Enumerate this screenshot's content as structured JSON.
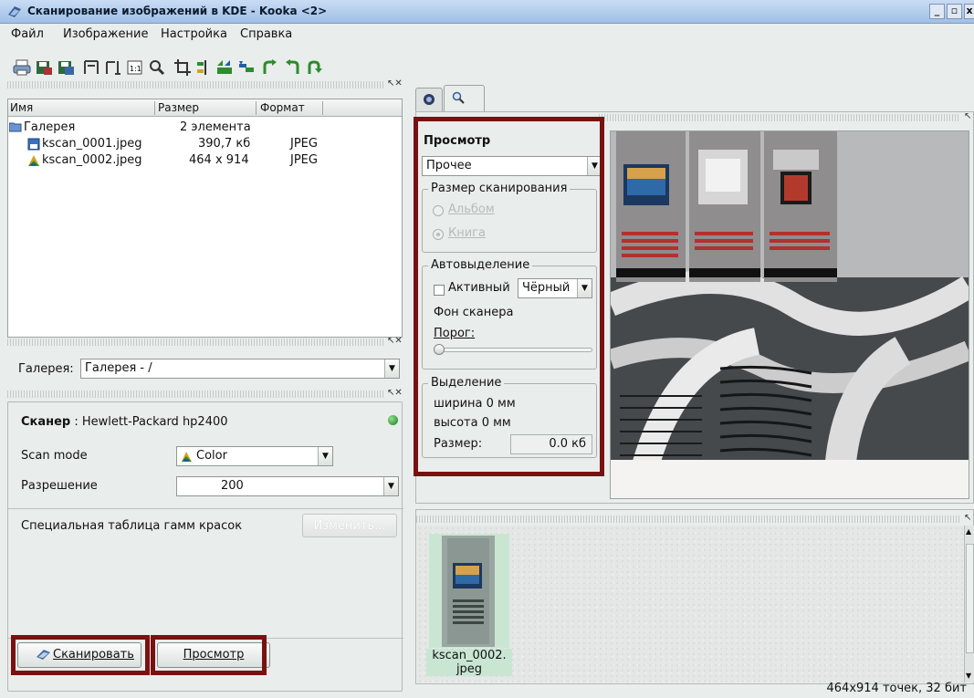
{
  "window": {
    "title": "Сканирование изображений в KDE - Kooka <2>",
    "controls": [
      "_",
      "▫",
      "×"
    ]
  },
  "menu": [
    {
      "label": "Файл"
    },
    {
      "label": "Изображение"
    },
    {
      "label": "Настройка"
    },
    {
      "label": "Справка"
    }
  ],
  "gallery": {
    "columns": [
      "Имя",
      "Размер",
      "Формат"
    ],
    "folder": {
      "name": "Галерея",
      "size": "2 элемента"
    },
    "files": [
      {
        "name": "kscan_0001.jpeg",
        "size": "390,7 кб",
        "format": "JPEG"
      },
      {
        "name": "kscan_0002.jpeg",
        "size": "464 x 914",
        "format": "JPEG"
      }
    ],
    "path_label": "Галерея:",
    "path_value": "Галерея - /"
  },
  "scanner": {
    "label": "Сканер",
    "name": ": Hewlett-Packard hp2400",
    "scan_mode_label": "Scan mode",
    "scan_mode_value": "Color",
    "resolution_label": "Разрешение",
    "resolution_value": "200",
    "gamma_label": "Специальная таблица гамм красок",
    "gamma_button": "Изменить..."
  },
  "actions": {
    "scan_button": "Сканировать",
    "preview_button": "Просмотр"
  },
  "preview": {
    "heading": "Просмотр",
    "size_combo": "Прочее",
    "scan_size_group": "Размер сканирования",
    "radio_album": "Альбом",
    "radio_book": "Книга",
    "auto_group": "Автовыделение",
    "auto_active": "Активный",
    "auto_color": "Чёрный",
    "bg_label": "Фон сканера",
    "threshold_label": "Порог:",
    "selection_group": "Выделение",
    "width_text": "ширина 0 мм",
    "height_text": "высота 0 мм",
    "size_label": "Размер:",
    "size_value": "0.0 кб"
  },
  "thumbnail": {
    "caption_line1": "kscan_0002.",
    "caption_line2": "jpeg"
  },
  "statusbar": {
    "text": "464x914 точек, 32 бит"
  }
}
